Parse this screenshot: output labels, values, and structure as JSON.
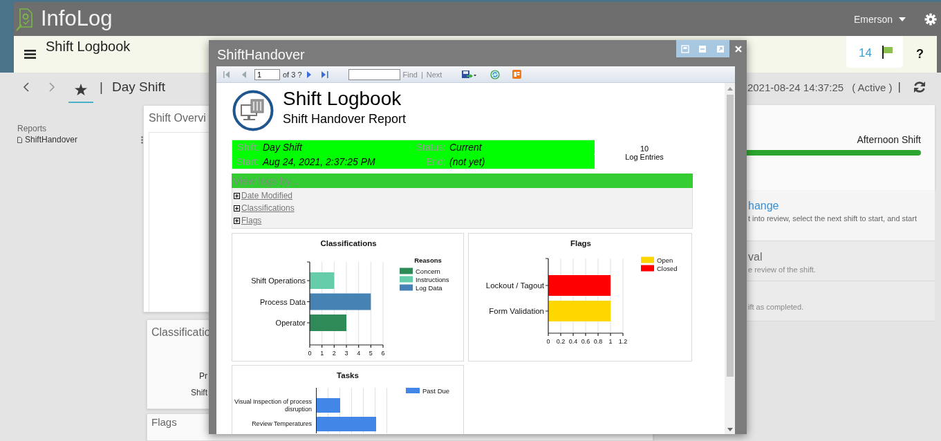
{
  "app": {
    "title": "InfoLog",
    "user": "Emerson"
  },
  "header": {
    "title": "Shift Logbook",
    "flag_count": "14",
    "help": "?"
  },
  "nav": {
    "separator_left": "|",
    "shift": "Day Shift",
    "timestamp": "2021-08-24 14:37:25",
    "status": "( Active )",
    "separator_right": "|"
  },
  "sidebar": {
    "section": "Reports",
    "items": [
      {
        "label": "ShiftHandover"
      }
    ]
  },
  "overview_cards": [
    {
      "title": "Shift Overvi"
    },
    {
      "title": "Classificatio",
      "lines": [
        "Pr",
        "Shift"
      ]
    },
    {
      "title": "Flags"
    }
  ],
  "shift_card": {
    "next_shift": "Afternoon Shift"
  },
  "actions": [
    {
      "title": "hange",
      "description": "t into review, select the next shift to start, and start",
      "disabled": false
    },
    {
      "title": "val",
      "description": "e review of the shift.",
      "disabled": true
    },
    {
      "description": "ift as completed.",
      "disabled": true
    }
  ],
  "dialog": {
    "title": "ShiftHandover",
    "toolbar": {
      "page": "1",
      "page_count": "of 3 ?",
      "find": "Find",
      "separator": "|",
      "next": "Next"
    },
    "report": {
      "title": "Shift Logbook",
      "subtitle": "Shift Handover Report",
      "info": [
        {
          "label": "Shift:",
          "value": "Day Shift"
        },
        {
          "label": "Status:",
          "value": "Current"
        },
        {
          "label": "Start:",
          "value": "Aug 24, 2021, 2:37:25 PM"
        },
        {
          "label": "End:",
          "value": "(not yet)"
        }
      ],
      "entries_count": "10",
      "entries_label": "Log Entries",
      "view_logs": {
        "heading": "View logs by...",
        "groups": [
          {
            "label": "Date Modified",
            "expanded": false
          },
          {
            "label": "Classifications",
            "expanded": false
          },
          {
            "label": "Flags",
            "expanded": false
          }
        ]
      },
      "charts": [
        {
          "legend_title": "Reasons",
          "chart_data": {
            "type": "bar",
            "orientation": "horizontal",
            "title": "Classifications",
            "categories": [
              "Shift Operations",
              "Process Data",
              "Operator"
            ],
            "series": [
              {
                "name": "Concern",
                "color": "#2e8b57",
                "values": [
                  null,
                  null,
                  3
                ]
              },
              {
                "name": "Instructions",
                "color": "#66cdaa",
                "values": [
                  2,
                  null,
                  null
                ]
              },
              {
                "name": "Log Data",
                "color": "#4682b4",
                "values": [
                  null,
                  5,
                  null
                ]
              }
            ],
            "xlim": [
              0,
              6
            ],
            "xticks": [
              0,
              1,
              2,
              3,
              4,
              5,
              6
            ],
            "grid": true,
            "legend": true
          }
        },
        {
          "chart_data": {
            "type": "bar",
            "orientation": "horizontal",
            "title": "Flags",
            "categories": [
              "Lockout / Tagout",
              "Form Validation"
            ],
            "series": [
              {
                "name": "Open",
                "color": "#ffd700",
                "values": [
                  null,
                  1
                ]
              },
              {
                "name": "Closed",
                "color": "#ff0000",
                "values": [
                  1,
                  null
                ]
              }
            ],
            "xlim": [
              0,
              1.2
            ],
            "xticks": [
              0,
              0.2,
              0.4,
              0.6,
              0.8,
              1,
              1.2
            ],
            "grid": true,
            "legend": true
          }
        }
      ],
      "tasks": {
        "title": "Tasks",
        "legend": "Past Due",
        "categories": [
          "Visual Inspection of process disruption",
          "Review Temperatures"
        ]
      }
    }
  }
}
